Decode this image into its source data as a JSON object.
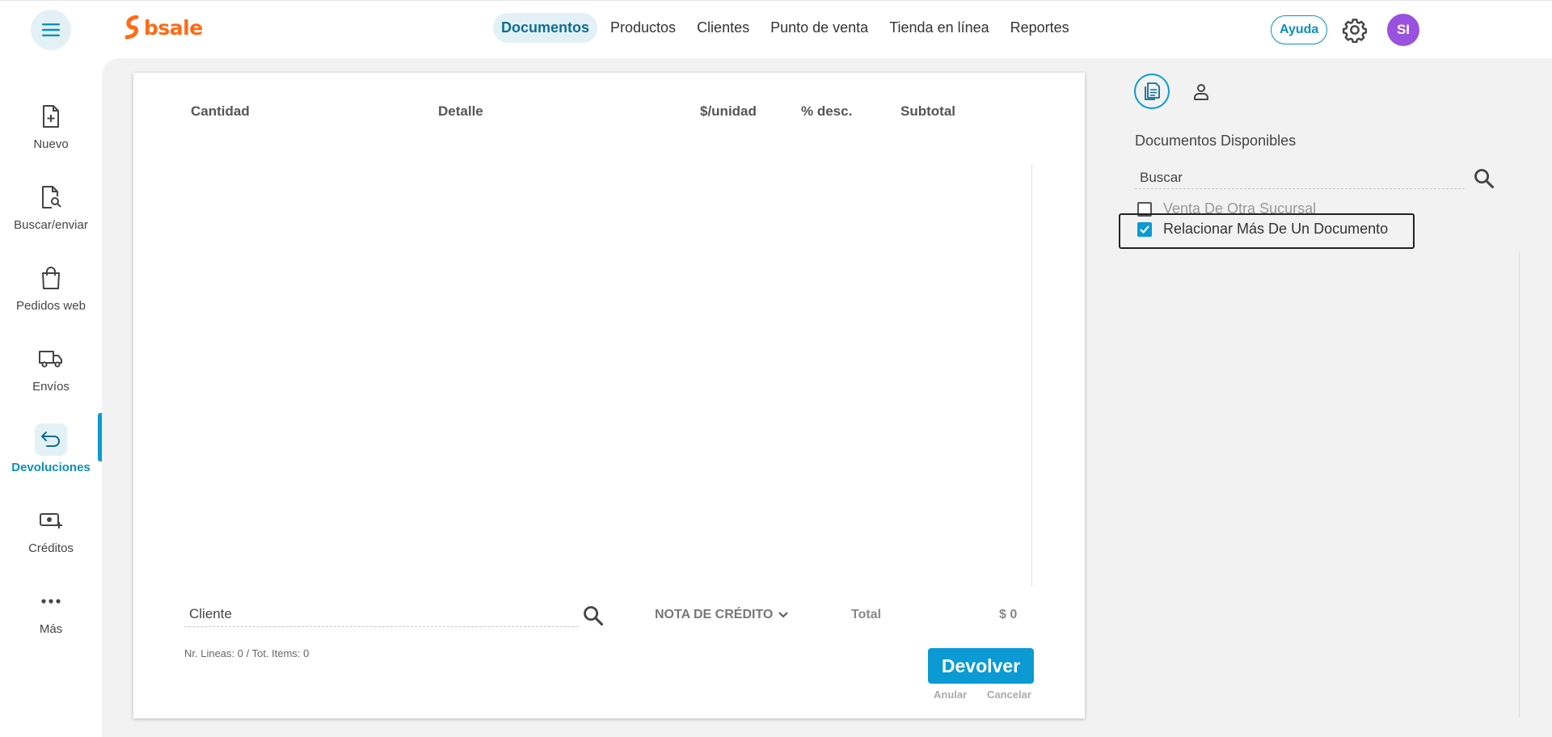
{
  "header": {
    "brand": "bsale",
    "nav": [
      {
        "label": "Documentos",
        "active": true
      },
      {
        "label": "Productos",
        "active": false
      },
      {
        "label": "Clientes",
        "active": false
      },
      {
        "label": "Punto de venta",
        "active": false
      },
      {
        "label": "Tienda en línea",
        "active": false
      },
      {
        "label": "Reportes",
        "active": false
      }
    ],
    "help_label": "Ayuda",
    "avatar_initials": "SI"
  },
  "sidebar": {
    "items": [
      {
        "label": "Nuevo",
        "icon": "file-plus-icon"
      },
      {
        "label": "Buscar/enviar",
        "icon": "file-search-icon"
      },
      {
        "label": "Pedidos web",
        "icon": "shopping-bag-icon"
      },
      {
        "label": "Envíos",
        "icon": "truck-icon"
      },
      {
        "label": "Devoluciones",
        "icon": "return-arrow-icon",
        "active": true
      },
      {
        "label": "Créditos",
        "icon": "cash-plus-icon"
      },
      {
        "label": "Más",
        "icon": "more-dots-icon"
      }
    ]
  },
  "document": {
    "columns": [
      "Cantidad",
      "Detalle",
      "$/unidad",
      "% desc.",
      "Subtotal"
    ],
    "cliente_placeholder": "Cliente",
    "doc_type": "NOTA DE CRÉDITO",
    "total_label": "Total",
    "total_value": "$ 0",
    "counts": "Nr. Lineas: 0 / Tot. Items: 0",
    "submit_label": "Devolver",
    "anular_label": "Anular",
    "cancelar_label": "Cancelar"
  },
  "right_panel": {
    "title": "Documentos Disponibles",
    "search_placeholder": "Buscar",
    "options": [
      {
        "label": "Venta De Otra Sucursal",
        "checked": false
      },
      {
        "label": "Relacionar Más De Un Documento",
        "checked": true
      }
    ]
  },
  "colors": {
    "accent": "#0b9ad3",
    "brand": "#ff6a13",
    "avatar": "#9b51e0",
    "panel_bg": "#f2f2f2"
  }
}
